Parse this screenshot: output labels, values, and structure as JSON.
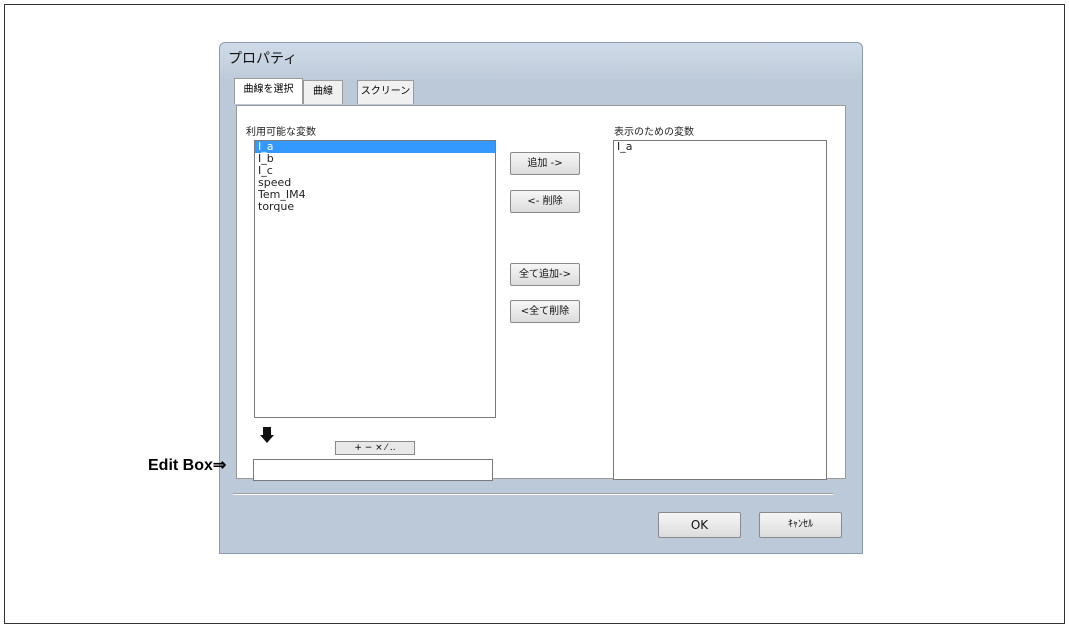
{
  "dialog": {
    "title": "プロパティ"
  },
  "tabs": [
    "曲線を選択",
    "曲線",
    "スクリーン"
  ],
  "available": {
    "label": "利用可能な変数",
    "items": [
      "I_a",
      "I_b",
      "I_c",
      "speed",
      "Tem_IM4",
      "torque"
    ],
    "selected_index": 0
  },
  "display": {
    "label": "表示のための変数",
    "items": [
      "I_a"
    ]
  },
  "buttons": {
    "add": "追加 ->",
    "remove": "<- 削除",
    "add_all": "全て追加->",
    "remove_all": "<全て削除",
    "ok": "OK",
    "cancel": "ｷｬﾝｾﾙ"
  },
  "operator_bar": "+ − × ⁄ ..",
  "edit_box": {
    "value": "",
    "annotation": "Edit Box⇒"
  },
  "icons": {
    "down_arrow": "arrow-down-icon"
  }
}
